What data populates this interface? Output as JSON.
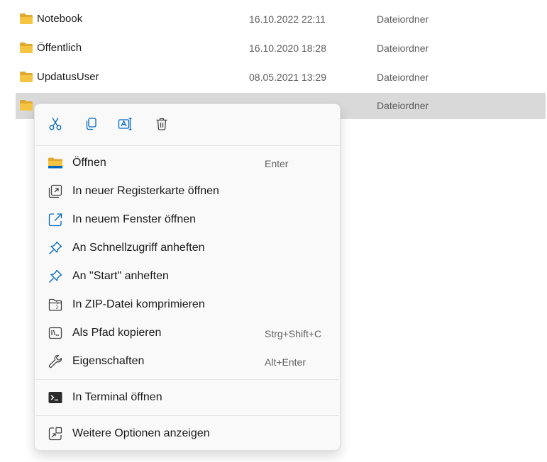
{
  "files": [
    {
      "name": "Notebook",
      "date": "16.10.2022 22:11",
      "type": "Dateiordner"
    },
    {
      "name": "Öffentlich",
      "date": "16.10.2020 18:28",
      "type": "Dateiordner"
    },
    {
      "name": "UpdatusUser",
      "date": "08.05.2021 13:29",
      "type": "Dateiordner"
    },
    {
      "name": "",
      "date": "",
      "type": "Dateiordner",
      "selected": true
    }
  ],
  "colors": {
    "folder": "#f5c542",
    "folder_dark": "#e0a82e",
    "accent": "#0067c0",
    "selection": "#d9d9d9",
    "menu_bg": "#f9f9f9"
  },
  "context_menu": {
    "quick_actions": [
      {
        "icon": "cut-icon"
      },
      {
        "icon": "copy-icon"
      },
      {
        "icon": "rename-icon"
      },
      {
        "icon": "delete-icon"
      }
    ],
    "items": [
      {
        "label": "Öffnen",
        "shortcut": "Enter",
        "icon": "open-folder-icon"
      },
      {
        "label": "In neuer Registerkarte öffnen",
        "shortcut": "",
        "icon": "new-tab-icon"
      },
      {
        "label": "In neuem Fenster öffnen",
        "shortcut": "",
        "icon": "new-window-icon"
      },
      {
        "label": "An Schnellzugriff anheften",
        "shortcut": "",
        "icon": "pin-icon"
      },
      {
        "label": "An \"Start\" anheften",
        "shortcut": "",
        "icon": "pin-start-icon"
      },
      {
        "label": "In ZIP-Datei komprimieren",
        "shortcut": "",
        "icon": "zip-icon"
      },
      {
        "label": "Als Pfad kopieren",
        "shortcut": "Strg+Shift+C",
        "icon": "copy-path-icon"
      },
      {
        "label": "Eigenschaften",
        "shortcut": "Alt+Enter",
        "icon": "properties-wrench-icon"
      },
      {
        "label": "In Terminal öffnen",
        "shortcut": "",
        "icon": "terminal-icon"
      },
      {
        "label": "Weitere Optionen anzeigen",
        "shortcut": "",
        "icon": "more-options-icon"
      }
    ]
  }
}
